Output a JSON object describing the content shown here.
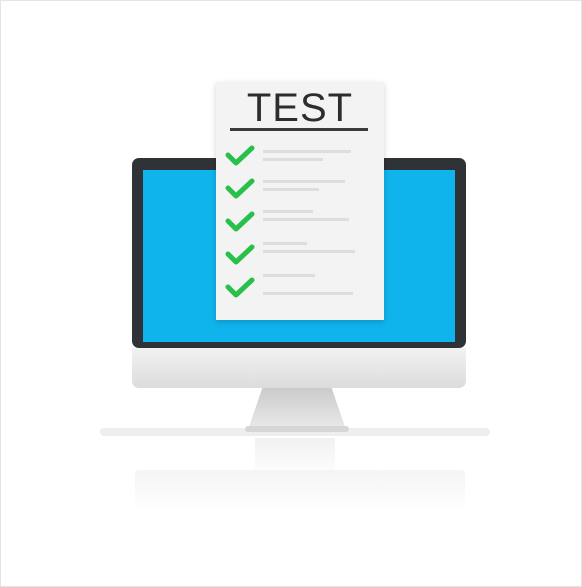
{
  "document": {
    "title": "TEST",
    "checklist": [
      {
        "checked": true
      },
      {
        "checked": true
      },
      {
        "checked": true
      },
      {
        "checked": true
      },
      {
        "checked": true
      }
    ]
  },
  "icons": {
    "monitor": "desktop-monitor-icon",
    "document": "test-document-icon",
    "check": "green-check-icon"
  },
  "colors": {
    "screen": "#0fb4ec",
    "bezel": "#2f3236",
    "chin": "#e9e9e9",
    "check": "#28c04a",
    "paper": "#f3f3f3",
    "title": "#2d2d2d"
  }
}
